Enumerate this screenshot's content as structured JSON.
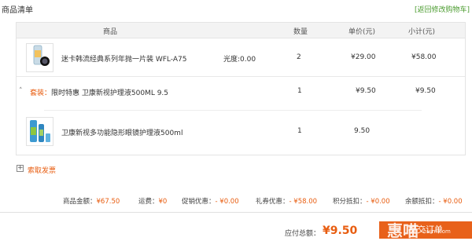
{
  "header": {
    "title": "商品清单",
    "back_link": "[返回修改购物车]"
  },
  "table": {
    "columns": [
      "商品",
      "数量",
      "单价(元)",
      "小计(元)"
    ],
    "item1": {
      "name": "迷卡韩流经典系列年抛一片装 WFL-A75",
      "spec": "光度:0.00",
      "qty": "2",
      "price": "¥29.00",
      "subtotal": "¥58.00"
    },
    "package": {
      "toggle": "˄",
      "tag": "套装：",
      "name": "限时特惠 卫康新视护理液500ML 9.5",
      "qty": "1",
      "price": "¥9.50",
      "subtotal": "¥9.50"
    },
    "item2": {
      "name": "卫康新视多功能隐形眼镜护理液500ml",
      "qty": "1",
      "price": "9.50"
    }
  },
  "invoice": {
    "add_symbol": "+",
    "label": "索取发票"
  },
  "summary": {
    "goods_label": "商品金额：",
    "goods_val": "¥67.50",
    "ship_label": "运费：",
    "ship_val": "¥0",
    "promo_label": "促销优惠：",
    "promo_val": "- ¥0.00",
    "coupon_label": "礼券优惠：",
    "coupon_val": "- ¥58.00",
    "points_label": "积分抵扣：",
    "points_val": "- ¥0.00",
    "balance_label": "余额抵扣：",
    "balance_val": "- ¥0.00"
  },
  "footer": {
    "payable_label": "应付总额：",
    "payable_val": "¥9.50",
    "submit_label": "提交订单",
    "watermark": "惠喵",
    "watermark_url": "huim.com"
  },
  "colors": {
    "accent": "#e85d10",
    "link_green": "#4a9b2e"
  }
}
